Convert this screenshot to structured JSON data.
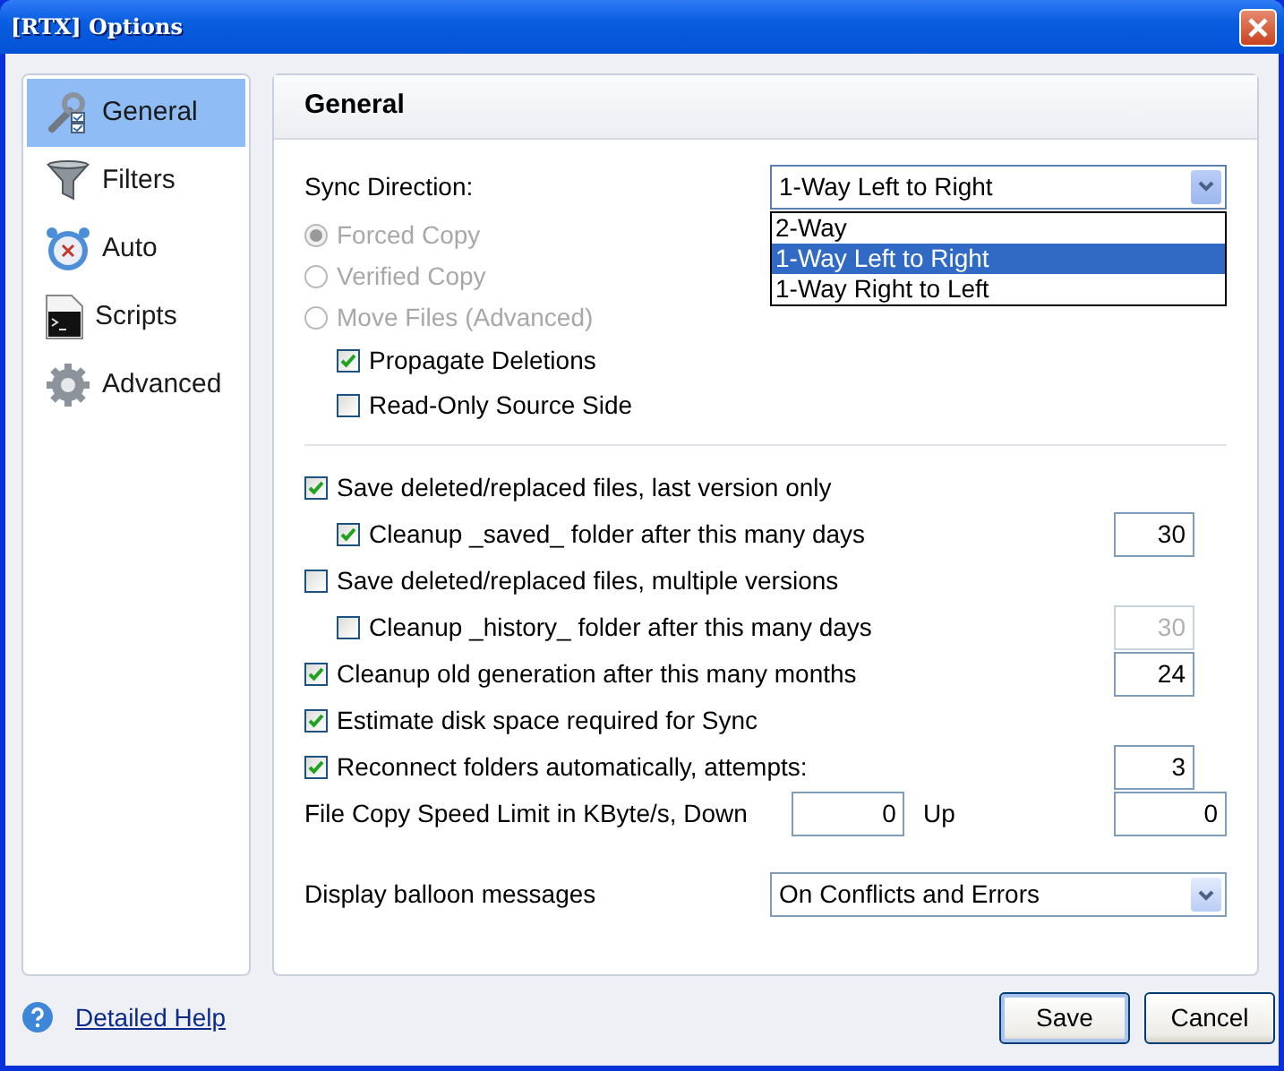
{
  "window": {
    "title": "[RTX] Options"
  },
  "sidebar": {
    "items": [
      {
        "label": "General",
        "selected": true
      },
      {
        "label": "Filters",
        "selected": false
      },
      {
        "label": "Auto",
        "selected": false
      },
      {
        "label": "Scripts",
        "selected": false
      },
      {
        "label": "Advanced",
        "selected": false
      }
    ]
  },
  "panel": {
    "title": "General"
  },
  "sync_direction": {
    "label": "Sync Direction:",
    "value": "1-Way Left to Right",
    "expanded": true,
    "options": [
      {
        "label": "2-Way",
        "selected": false
      },
      {
        "label": "1-Way Left to Right",
        "selected": true
      },
      {
        "label": "1-Way Right to Left",
        "selected": false
      }
    ]
  },
  "copy_modes": [
    {
      "label": "Forced Copy",
      "selected": true,
      "disabled": true
    },
    {
      "label": "Verified Copy",
      "selected": false,
      "disabled": true
    },
    {
      "label": "Move Files (Advanced)",
      "selected": false,
      "disabled": true
    }
  ],
  "sync_options": [
    {
      "label": "Propagate Deletions",
      "checked": true
    },
    {
      "label": "Read-Only Source Side",
      "checked": false
    }
  ],
  "options": [
    {
      "kind": "check",
      "label": "Save deleted/replaced files, last version only",
      "checked": true,
      "children": [
        {
          "kind": "check",
          "label": "Cleanup _saved_ folder after this many days",
          "checked": true,
          "field": {
            "value": "30",
            "disabled": false
          }
        }
      ]
    },
    {
      "kind": "check",
      "label": "Save deleted/replaced files, multiple versions",
      "checked": false,
      "children": [
        {
          "kind": "check",
          "label": "Cleanup _history_ folder after this many days",
          "checked": false,
          "field": {
            "value": "30",
            "disabled": true
          }
        }
      ]
    },
    {
      "kind": "check",
      "label": "Cleanup old generation after this many months",
      "checked": true,
      "field": {
        "value": "24",
        "disabled": false
      }
    },
    {
      "kind": "check",
      "label": "Estimate disk space required for Sync",
      "checked": true
    },
    {
      "kind": "check",
      "label": "Reconnect folders automatically, attempts:",
      "checked": true,
      "field": {
        "value": "3",
        "disabled": false
      }
    },
    {
      "kind": "speed",
      "label": "File Copy Speed Limit in KByte/s, Down",
      "down": "0",
      "up_label": "Up",
      "up": "0"
    }
  ],
  "balloon": {
    "label": "Display balloon messages",
    "value": "On Conflicts and Errors"
  },
  "footer": {
    "help_link": "Detailed Help",
    "buttons": [
      "Save",
      "Cancel"
    ]
  }
}
